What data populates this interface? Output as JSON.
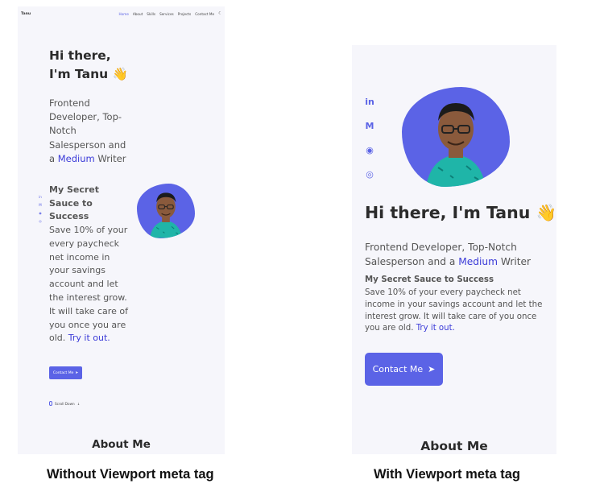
{
  "nav": {
    "logo": "Tanu",
    "links": [
      "Home",
      "About",
      "Skills",
      "Services",
      "Projects",
      "Contact Me"
    ],
    "active_link": "Home",
    "theme_toggle_icon": "moon-icon"
  },
  "hero": {
    "greeting": "Hi there, I'm Tanu 👋",
    "greeting_line1": "Hi there,",
    "greeting_line2": "I'm Tanu 👋",
    "subtitle_prefix": "Frontend Developer, Top-Notch Salesperson and a ",
    "subtitle_link": "Medium",
    "subtitle_suffix": " Writer",
    "secret_title": "My Secret Sauce to Success",
    "secret_body": "Save 10% of your every paycheck net income in your savings account and let the interest grow. It will take care of you once you are old. ",
    "secret_link": "Try it out.",
    "button_label": "Contact Me",
    "scroll_label": "Scroll Down",
    "scroll_arrow": "↓"
  },
  "social_icons": [
    {
      "name": "linkedin-icon",
      "glyph": "in"
    },
    {
      "name": "medium-icon",
      "glyph": "M"
    },
    {
      "name": "github-icon",
      "glyph": "◉"
    },
    {
      "name": "instagram-icon",
      "glyph": "◎"
    }
  ],
  "about_heading": "About Me",
  "captions": {
    "left": "Without Viewport meta tag",
    "right": "With Viewport meta tag"
  },
  "colors": {
    "accent": "#5b63e6",
    "link": "#3b3bd8",
    "panel_bg": "#f6f6fb",
    "avatar_shirt": "#1fb5a8",
    "skin": "#8a5a3c"
  }
}
